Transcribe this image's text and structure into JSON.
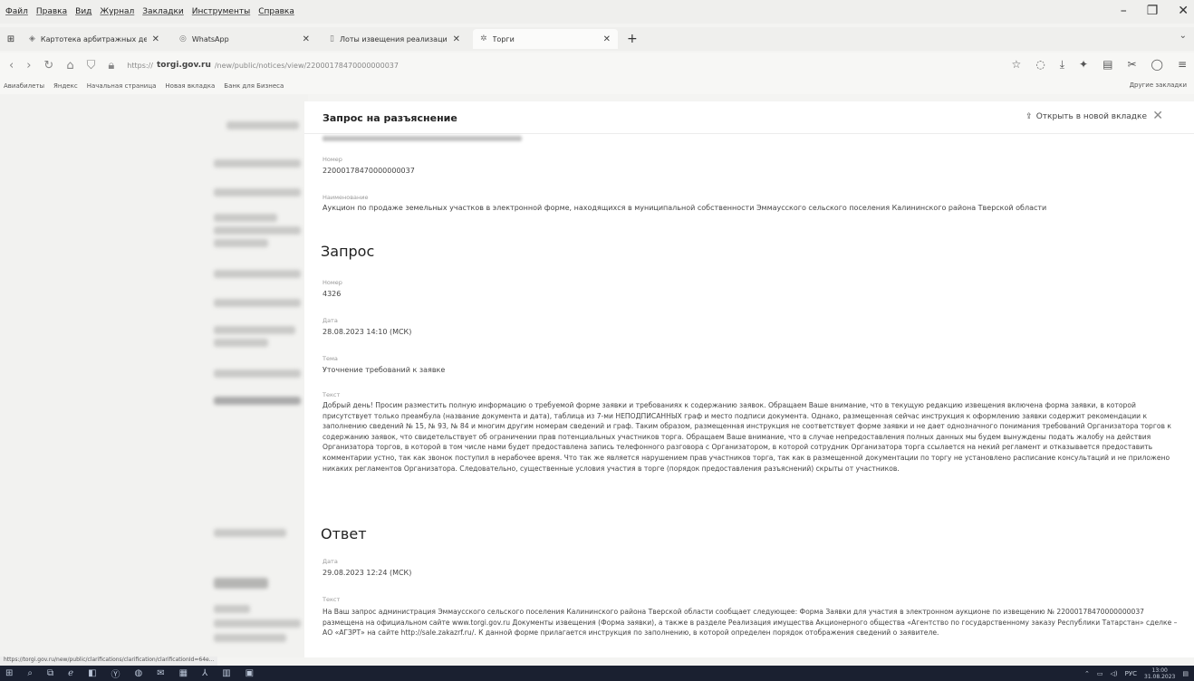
{
  "browser": {
    "menu": [
      "Файл",
      "Правка",
      "Вид",
      "Журнал",
      "Закладки",
      "Инструменты",
      "Справка"
    ],
    "tabs": [
      {
        "label": "Картотека арбитражных дел"
      },
      {
        "label": "WhatsApp"
      },
      {
        "label": "Лоты извещения реализаци"
      },
      {
        "label": "Торги"
      }
    ],
    "url_prefix": "https://",
    "url_host": "torgi.gov.ru",
    "url_path": "/new/public/notices/view/22000178470000000037",
    "bookmarks": [
      "Авиабилеты",
      "Яндекс",
      "Начальная страница",
      "Новая вкладка",
      "Банк для Бизнеса"
    ],
    "other_bookmarks": "Другие закладки",
    "status_url": "https://torgi.gov.ru/new/public/clarifications/clarification/clarificationId=64e..."
  },
  "modal": {
    "title": "Запрос на разъяснение",
    "open_new_tab": "Открыть в новой вкладке",
    "notice": {
      "number_label": "Номер",
      "number": "22000178470000000037",
      "name_label": "Наименование",
      "name": "Аукцион по продаже земельных участков в электронной форме, находящихся в муниципальной собственности Эммаусского сельского поселения Калининского района Тверской области"
    },
    "request": {
      "heading": "Запрос",
      "number_label": "Номер",
      "number": "4326",
      "date_label": "Дата",
      "date": "28.08.2023 14:10 (МСК)",
      "topic_label": "Тема",
      "topic": "Уточнение требований к заявке",
      "text_label": "Текст",
      "text": "Добрый день! Просим разместить полную информацию о требуемой форме заявки и требованиях к содержанию заявок. Обращаем Ваше внимание, что в текущую редакцию извещения включена форма заявки, в которой присутствует только преамбула (название документа и дата), таблица из 7-ми НЕПОДПИСАННЫХ граф и место подписи документа. Однако, размещенная сейчас инструкция к оформлению заявки содержит рекомендации к заполнению сведений № 15, № 93, № 84 и многим другим номерам сведений и граф. Таким образом, размещенная инструкция не соответствует форме заявки и не дает однозначного понимания требований Организатора торгов к содержанию заявок, что свидетельствует об ограничении прав потенциальных участников торга. Обращаем Ваше внимание, что в случае непредоставления полных данных мы будем вынуждены подать жалобу на действия Организатора торгов, в которой в том числе нами будет предоставлена запись телефонного разговора с Организатором, в которой сотрудник Организатора торга ссылается на некий регламент и отказывается предоставить комментарии устно, так как звонок поступил в нерабочее время. Что так же является нарушением прав участников торга, так как в размещенной документации по торгу не установлено расписание консультаций и не приложено никаких регламентов Организатора. Следовательно, существенные условия участия в торге (порядок предоставления разъяснений) скрыты от участников."
    },
    "answer": {
      "heading": "Ответ",
      "date_label": "Дата",
      "date": "29.08.2023 12:24 (МСК)",
      "text_label": "Текст",
      "text": "На Ваш запрос администрация Эммаусского сельского поселения Калининского района Тверской области сообщает следующее: Форма Заявки для участия в электронном аукционе по извещению № 22000178470000000037 размещена на официальном сайте www.torgi.gov.ru Документы извещения (Форма заявки), а также в разделе Реализация имущества Акционерного общества «Агентство по государственному заказу Республики Татарстан» сделке – АО «АГЗРТ» на сайте http://sale.zakazrf.ru/. К данной форме прилагается инструкция по заполнению, в которой определен порядок отображения сведений о заявителе."
    }
  },
  "taskbar": {
    "lang": "РУС",
    "time": "13:00",
    "date": "31.08.2023"
  }
}
